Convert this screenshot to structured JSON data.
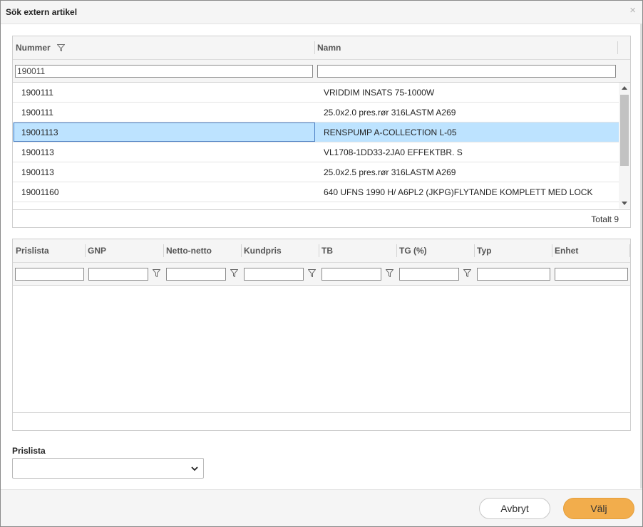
{
  "dialog": {
    "title": "Sök extern artikel",
    "close_symbol": "×"
  },
  "article_grid": {
    "columns": [
      {
        "label": "Nummer",
        "filter_icon": "filter-icon"
      },
      {
        "label": "Namn"
      }
    ],
    "filters": {
      "nummer": "190011",
      "namn": ""
    },
    "rows": [
      {
        "nummer": "1900111",
        "namn": "VRIDDIM INSATS 75-1000W",
        "selected": false
      },
      {
        "nummer": "1900111",
        "namn": "25.0x2.0 pres.rør 316LASTM A269",
        "selected": false
      },
      {
        "nummer": "19001113",
        "namn": "RENSPUMP A-COLLECTION L-05",
        "selected": true
      },
      {
        "nummer": "1900113",
        "namn": "VL1708-1DD33-2JA0 EFFEKTBR. S",
        "selected": false
      },
      {
        "nummer": "1900113",
        "namn": "25.0x2.5 pres.rør 316LASTM A269",
        "selected": false
      },
      {
        "nummer": "19001160",
        "namn": "640 UFNS 1990 H/ A6PL2 (JKPG)FLYTANDE KOMPLETT MED LOCK",
        "selected": false
      }
    ],
    "footer_total": "Totalt 9"
  },
  "price_grid": {
    "columns": [
      {
        "label": "Prislista",
        "has_filter": false
      },
      {
        "label": "GNP",
        "has_filter": true
      },
      {
        "label": "Netto-netto",
        "has_filter": true
      },
      {
        "label": "Kundpris",
        "has_filter": true
      },
      {
        "label": "TB",
        "has_filter": true
      },
      {
        "label": "TG (%)",
        "has_filter": true
      },
      {
        "label": "Typ",
        "has_filter": false
      },
      {
        "label": "Enhet",
        "has_filter": false
      }
    ],
    "rows": []
  },
  "prislista_select": {
    "label": "Prislista",
    "value": ""
  },
  "buttons": {
    "cancel": "Avbryt",
    "ok": "Välj"
  },
  "colors": {
    "selected_row": "#bde3ff",
    "ok_button": "#f2ad4c",
    "header_bg": "#f5f5f5"
  }
}
